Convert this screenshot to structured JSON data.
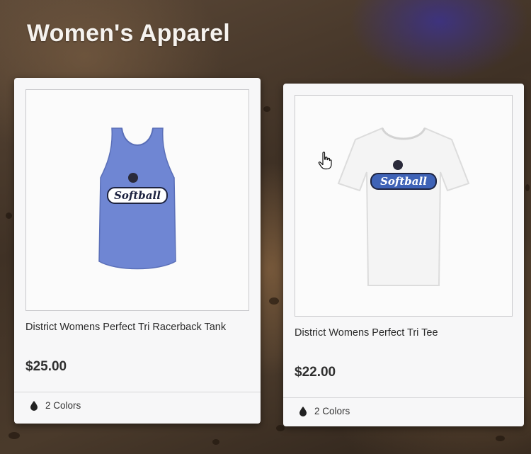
{
  "section": {
    "title": "Women's Apparel"
  },
  "products": [
    {
      "name": "District Womens Perfect Tri Racerback Tank",
      "price": "$25.00",
      "colors_label": "2 Colors",
      "image_icon": "tank-top-shirt-icon",
      "shirt_color": "#6f86d3",
      "graphic_text": "Softball"
    },
    {
      "name": "District Womens Perfect Tri Tee",
      "price": "$22.00",
      "colors_label": "2 Colors",
      "image_icon": "tshirt-icon",
      "shirt_color": "#f4f4f4",
      "graphic_text": "Softball"
    }
  ],
  "cursor": {
    "icon": "hand-pointer-icon"
  }
}
